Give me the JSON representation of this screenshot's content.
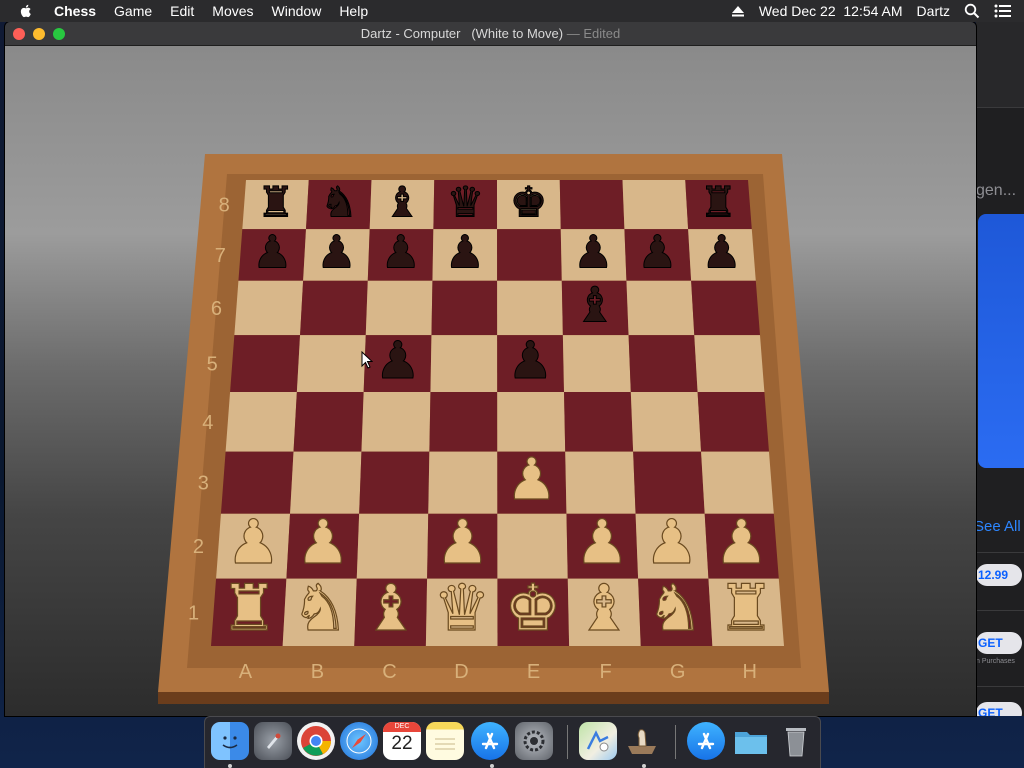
{
  "menubar": {
    "apple_icon": "apple-icon",
    "items": [
      "Chess",
      "Game",
      "Edit",
      "Moves",
      "Window",
      "Help"
    ],
    "clock": "Wed Dec 22  12:54 AM",
    "user": "Dartz"
  },
  "window": {
    "title": "Dartz - Computer   (White to Move)",
    "edited": "— Edited"
  },
  "board": {
    "ranks": [
      "8",
      "7",
      "6",
      "5",
      "4",
      "3",
      "2",
      "1"
    ],
    "files": [
      "A",
      "B",
      "C",
      "D",
      "E",
      "F",
      "G",
      "H"
    ],
    "pieces": [
      {
        "square": "a8",
        "color": "black",
        "type": "rook"
      },
      {
        "square": "b8",
        "color": "black",
        "type": "knight"
      },
      {
        "square": "c8",
        "color": "black",
        "type": "bishop"
      },
      {
        "square": "d8",
        "color": "black",
        "type": "queen"
      },
      {
        "square": "e8",
        "color": "black",
        "type": "king"
      },
      {
        "square": "h8",
        "color": "black",
        "type": "rook"
      },
      {
        "square": "a7",
        "color": "black",
        "type": "pawn"
      },
      {
        "square": "b7",
        "color": "black",
        "type": "pawn"
      },
      {
        "square": "c7",
        "color": "black",
        "type": "pawn"
      },
      {
        "square": "d7",
        "color": "black",
        "type": "pawn"
      },
      {
        "square": "f7",
        "color": "black",
        "type": "pawn"
      },
      {
        "square": "g7",
        "color": "black",
        "type": "pawn"
      },
      {
        "square": "h7",
        "color": "black",
        "type": "pawn"
      },
      {
        "square": "f6",
        "color": "black",
        "type": "bishop"
      },
      {
        "square": "c5",
        "color": "black",
        "type": "pawn"
      },
      {
        "square": "e5",
        "color": "black",
        "type": "pawn"
      },
      {
        "square": "e3",
        "color": "white",
        "type": "pawn"
      },
      {
        "square": "a2",
        "color": "white",
        "type": "pawn"
      },
      {
        "square": "b2",
        "color": "white",
        "type": "pawn"
      },
      {
        "square": "d2",
        "color": "white",
        "type": "pawn"
      },
      {
        "square": "f2",
        "color": "white",
        "type": "pawn"
      },
      {
        "square": "g2",
        "color": "white",
        "type": "pawn"
      },
      {
        "square": "h2",
        "color": "white",
        "type": "pawn"
      },
      {
        "square": "a1",
        "color": "white",
        "type": "rook"
      },
      {
        "square": "b1",
        "color": "white",
        "type": "knight"
      },
      {
        "square": "c1",
        "color": "white",
        "type": "bishop"
      },
      {
        "square": "d1",
        "color": "white",
        "type": "queen"
      },
      {
        "square": "e1",
        "color": "white",
        "type": "king"
      },
      {
        "square": "f1",
        "color": "white",
        "type": "bishop"
      },
      {
        "square": "g1",
        "color": "white",
        "type": "knight"
      },
      {
        "square": "h1",
        "color": "white",
        "type": "rook"
      }
    ]
  },
  "app_store": {
    "fragment": "gen...",
    "see_all": "See All",
    "price": "12.99",
    "get1": "GET",
    "in_app": "n Purchases",
    "get2": "GET"
  },
  "dock": {
    "calendar_month": "DEC",
    "calendar_day": "22",
    "icons": [
      "finder-icon",
      "launchpad-icon",
      "chrome-icon",
      "safari-icon",
      "calendar-icon",
      "notes-icon",
      "app-store-icon",
      "system-preferences-icon",
      "maps-icon",
      "chess-icon",
      "app-store-downloads-icon",
      "folder-icon",
      "trash-icon"
    ]
  },
  "colors": {
    "light_square": "#d8b78a",
    "dark_square": "#6e1e26",
    "board_frame": "#a8693a",
    "white_piece": "#e7c085",
    "black_piece": "#2a1412"
  }
}
